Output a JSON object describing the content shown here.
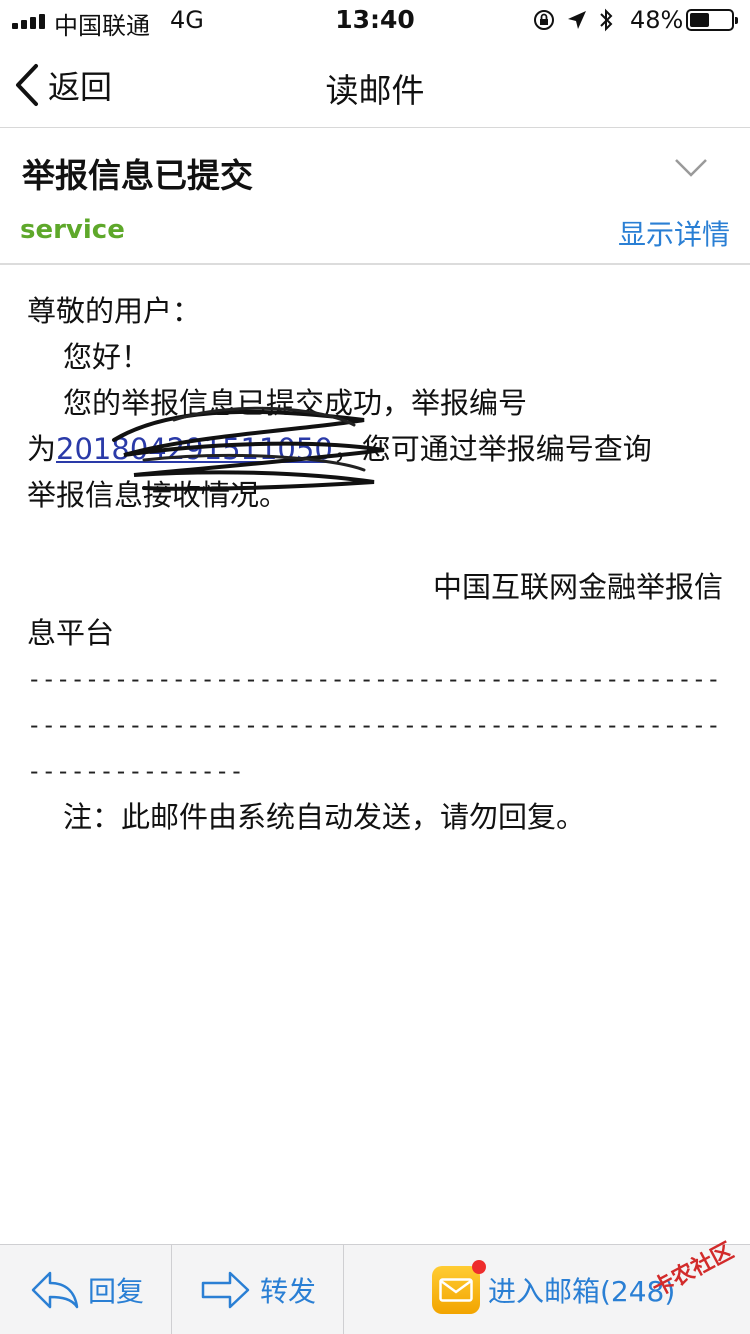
{
  "status_bar": {
    "carrier": "中国联通",
    "network": "4G",
    "time": "13:40",
    "battery_percent": "48%",
    "battery_level": 0.48,
    "icons": [
      "orientation-lock-icon",
      "location-icon",
      "bluetooth-icon"
    ]
  },
  "nav": {
    "back_label": "返回",
    "title": "读邮件"
  },
  "header": {
    "subject": "举报信息已提交",
    "sender": "service",
    "details_label": "显示详情"
  },
  "body": {
    "greeting": "尊敬的用户：",
    "hello": "您好！",
    "line1": "您的举报信息已提交成功，举报编号",
    "line2_prefix": "为",
    "ref_number": "201804291511050",
    "line2_suffix": "，您可通过举报编号查询",
    "line3": "举报信息接收情况。",
    "signature_part1": "中国互联网金融举报信",
    "signature_part2": "息平台",
    "dash_line1": "------------------------------------------------------------------------------------------",
    "dash_line2": "------------------------------------------------------------------------------------------",
    "dash_line3": "---------------",
    "note": "注：此邮件由系统自动发送，请勿回复。"
  },
  "toolbar": {
    "reply_label": "回复",
    "forward_label": "转发",
    "inbox_label": "进入邮箱(248)"
  },
  "watermark": "卡农社区",
  "colors": {
    "accent_blue": "#2a7fd4",
    "sender_green": "#5ea82a",
    "badge_red": "#ee2d2d",
    "mailbox_yellow": "#f2a400"
  }
}
